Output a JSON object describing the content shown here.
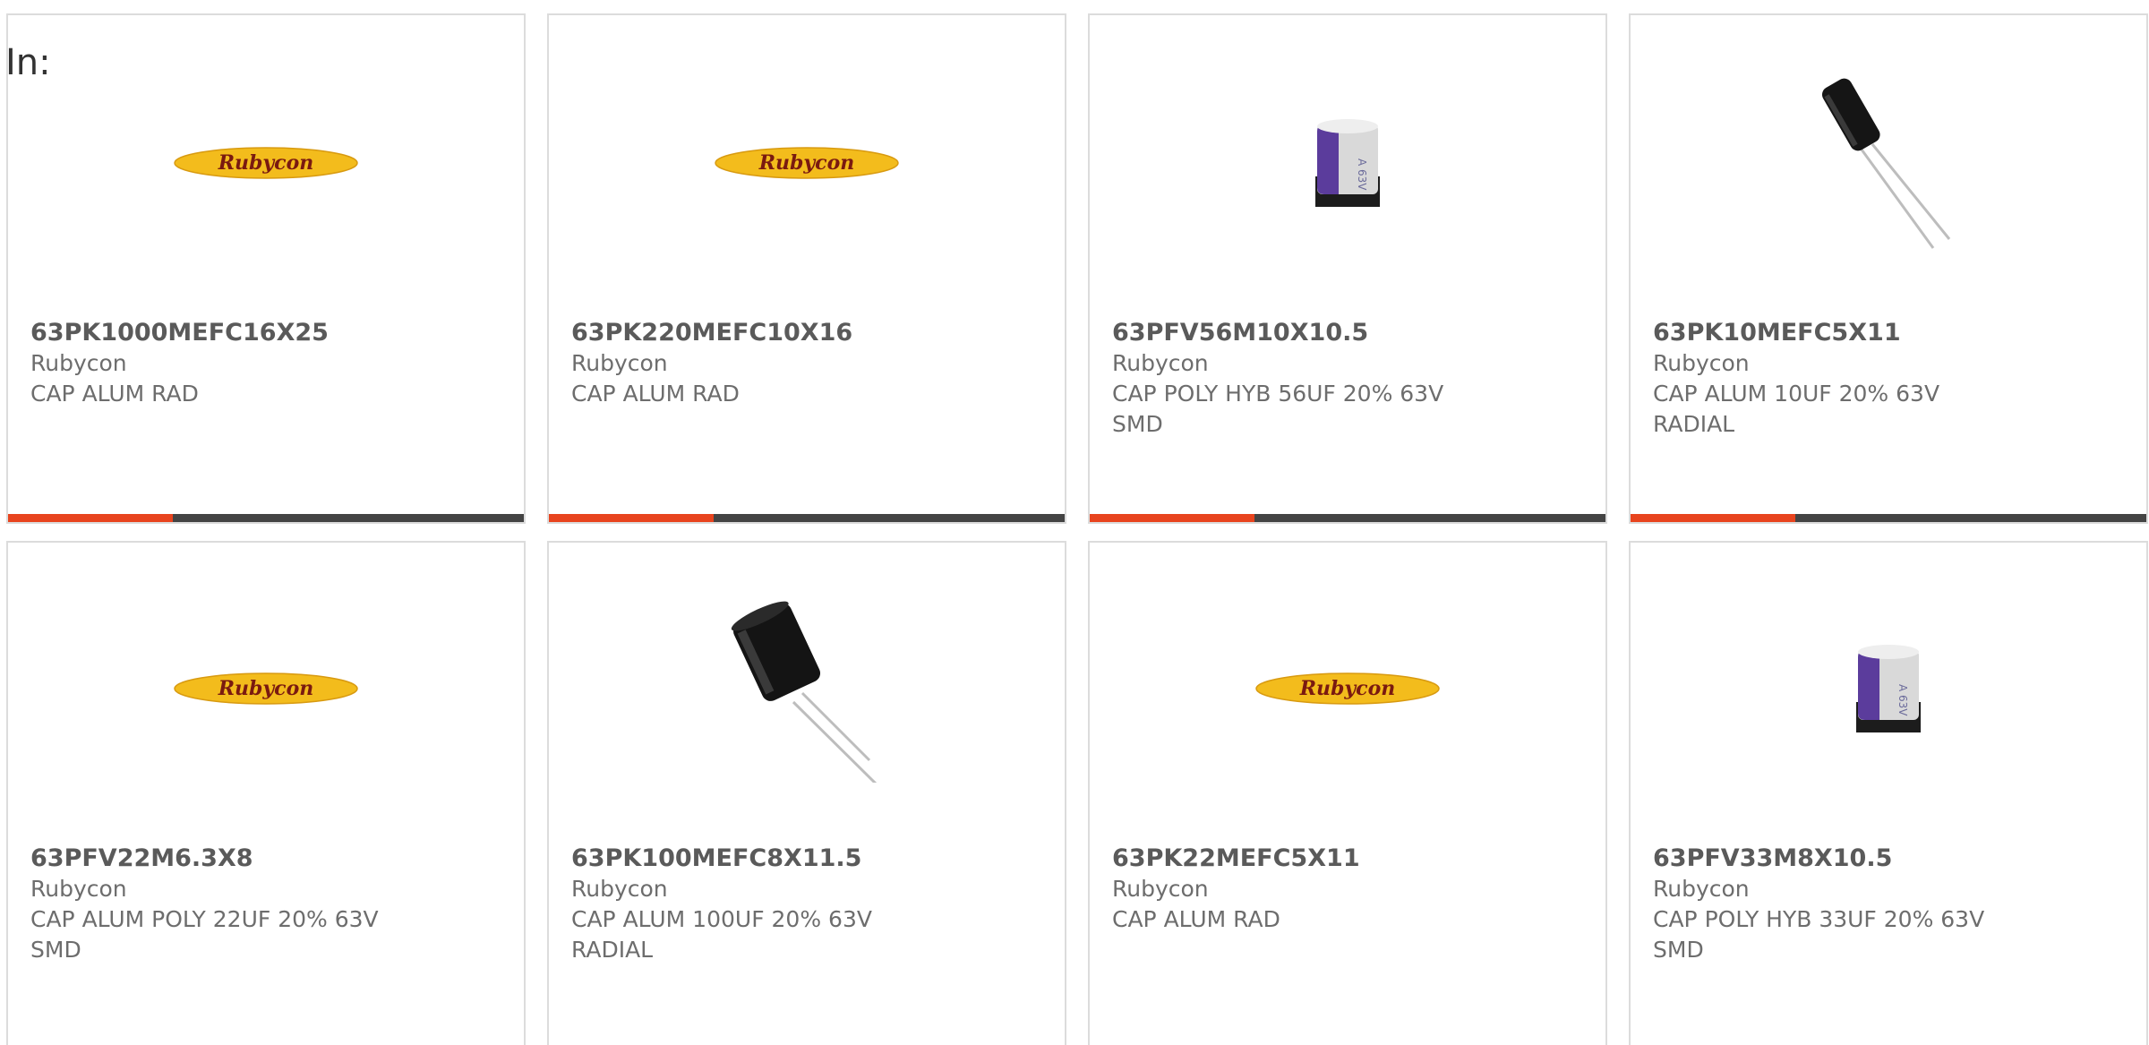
{
  "header": {
    "label": "In:"
  },
  "colors": {
    "accent": "#e8441e",
    "bar": "#444444",
    "border": "#dcdcdc",
    "logo_yellow": "#f3bc1c",
    "logo_text": "#7a1a10",
    "cap_sleeve": "#5b3c9c"
  },
  "products": [
    {
      "part": "63PK1000MEFC16X25",
      "manufacturer": "Rubycon",
      "description": "CAP ALUM RAD",
      "image": "rubycon-logo",
      "logo_text": "Rubycon",
      "progress": 0.32
    },
    {
      "part": "63PK220MEFC10X16",
      "manufacturer": "Rubycon",
      "description": "CAP ALUM RAD",
      "image": "rubycon-logo",
      "logo_text": "Rubycon",
      "progress": 0.32
    },
    {
      "part": "63PFV56M10X10.5",
      "manufacturer": "Rubycon",
      "description": "CAP POLY HYB 56UF 20% 63V\nSMD",
      "image": "smd-capacitor",
      "progress": 0.32
    },
    {
      "part": "63PK10MEFC5X11",
      "manufacturer": "Rubycon",
      "description": "CAP ALUM 10UF 20% 63V\nRADIAL",
      "image": "radial-capacitor-small",
      "progress": 0.32
    },
    {
      "part": "63PFV22M6.3X8",
      "manufacturer": "Rubycon",
      "description": "CAP ALUM POLY 22UF 20% 63V\nSMD",
      "image": "rubycon-logo",
      "logo_text": "Rubycon"
    },
    {
      "part": "63PK100MEFC8X11.5",
      "manufacturer": "Rubycon",
      "description": "CAP ALUM 100UF 20% 63V\nRADIAL",
      "image": "radial-capacitor-large"
    },
    {
      "part": "63PK22MEFC5X11",
      "manufacturer": "Rubycon",
      "description": "CAP ALUM RAD",
      "image": "rubycon-logo",
      "logo_text": "Rubycon"
    },
    {
      "part": "63PFV33M8X10.5",
      "manufacturer": "Rubycon",
      "description": "CAP POLY HYB 33UF 20% 63V\nSMD",
      "image": "smd-capacitor"
    }
  ]
}
